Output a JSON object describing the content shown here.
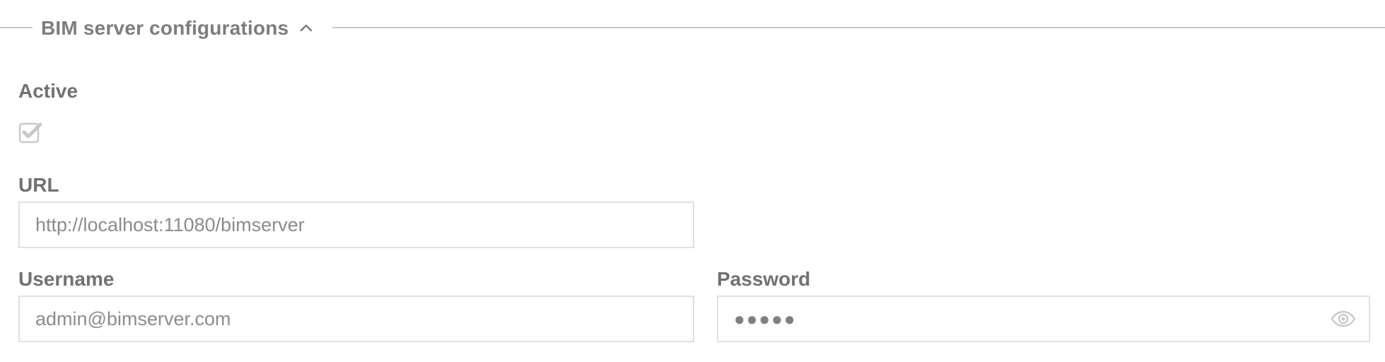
{
  "section": {
    "title": "BIM server configurations",
    "toggle_icon": "chevron-up-icon"
  },
  "active": {
    "label": "Active",
    "checked": true,
    "icon": "checkbox-checked-icon"
  },
  "url": {
    "label": "URL",
    "value": "http://localhost:11080/bimserver"
  },
  "username": {
    "label": "Username",
    "value": "admin@bimserver.com"
  },
  "password": {
    "label": "Password",
    "masked_value": "●●●●●",
    "visibility_icon": "eye-icon"
  },
  "colors": {
    "text": "#6f7174",
    "border": "#dfe0e2",
    "divider": "#c7c8ca",
    "muted_icon": "#c8c9cb"
  }
}
